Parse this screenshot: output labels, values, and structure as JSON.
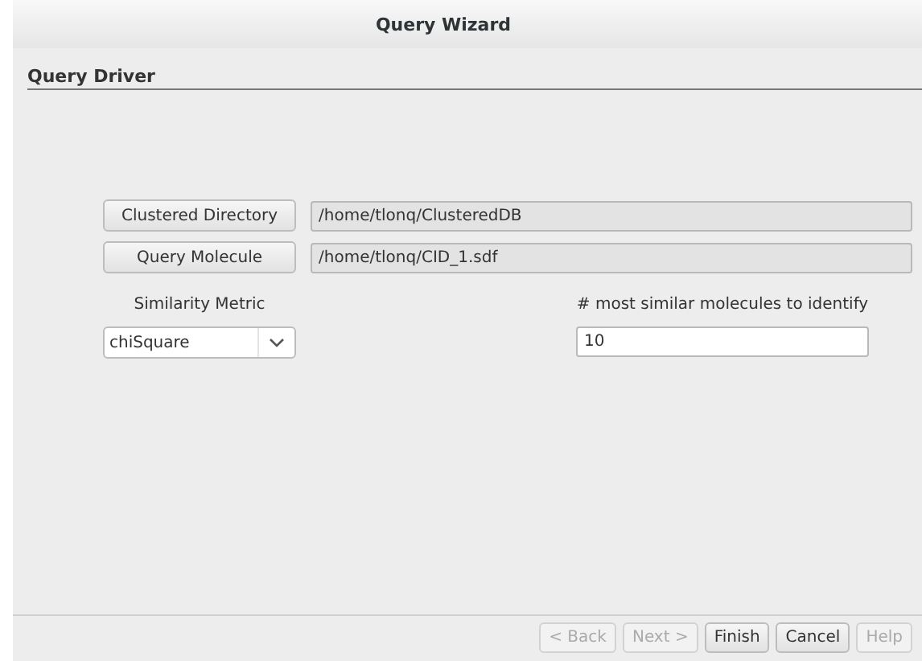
{
  "window": {
    "title": "Query Wizard"
  },
  "page": {
    "title": "Query Driver"
  },
  "file_rows": [
    {
      "button": "Clustered Directory",
      "value": "/home/tlonq/ClusteredDB",
      "editable": false
    },
    {
      "button": "Query Molecule",
      "value": "/home/tlonq/CID_1.sdf",
      "editable": false
    }
  ],
  "similarity_metric": {
    "label": "Similarity Metric",
    "value": "chiSquare"
  },
  "count": {
    "label": "# most similar molecules to identify",
    "value": "10"
  },
  "buttons": [
    {
      "label": "< Back",
      "disabled": true
    },
    {
      "label": "Next >",
      "disabled": true
    },
    {
      "label": "Finish",
      "disabled": false
    },
    {
      "label": "Cancel",
      "disabled": false
    },
    {
      "label": "Help",
      "disabled": true
    }
  ]
}
